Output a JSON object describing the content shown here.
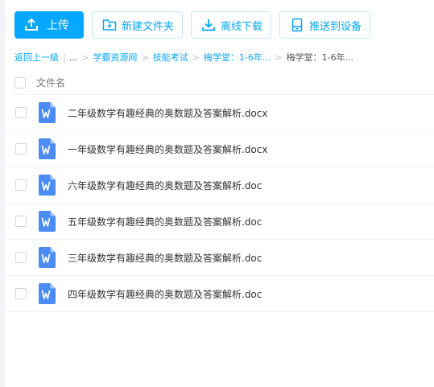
{
  "toolbar": {
    "upload_label": "上传",
    "new_folder_label": "新建文件夹",
    "offline_download_label": "离线下载",
    "push_device_label": "推送到设备"
  },
  "breadcrumb": {
    "back_label": "返回上一级",
    "ellipsis": "...",
    "items": [
      "学霸资源网",
      "技能考试",
      "梅学堂：1-6年..."
    ],
    "current": "梅学堂：1-6年..."
  },
  "list": {
    "header_label": "文件名",
    "files": [
      {
        "name": "二年级数学有趣经典的奥数题及答案解析.docx",
        "icon": "word-doc-icon"
      },
      {
        "name": "一年级数学有趣经典的奥数题及答案解析.docx",
        "icon": "word-doc-icon"
      },
      {
        "name": "六年级数学有趣经典的奥数题及答案解析.doc",
        "icon": "word-doc-icon"
      },
      {
        "name": "五年级数学有趣经典的奥数题及答案解析.doc",
        "icon": "word-doc-icon"
      },
      {
        "name": "三年级数学有趣经典的奥数题及答案解析.doc",
        "icon": "word-doc-icon"
      },
      {
        "name": "四年级数学有趣经典的奥数题及答案解析.doc",
        "icon": "word-doc-icon"
      }
    ]
  },
  "colors": {
    "accent": "#06a7ff",
    "word_blue": "#4a8bf5"
  }
}
